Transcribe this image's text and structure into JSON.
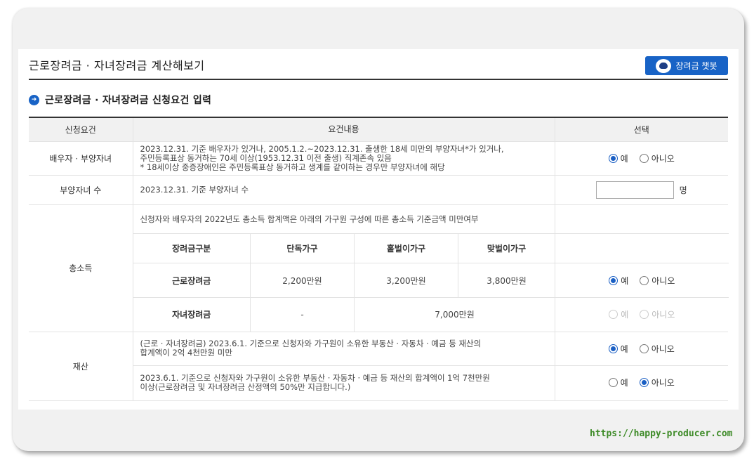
{
  "header": {
    "title": "근로장려금 · 자녀장려금 계산해보기",
    "chatbot_label": "장려금 챗봇"
  },
  "section": {
    "title": "근로장려금 · 자녀장려금 신청요건 입력"
  },
  "table": {
    "headers": [
      "신청요건",
      "요건내용",
      "선택"
    ],
    "rows": {
      "spouse": {
        "label": "배우자 · 부양자녀",
        "line1": "2023.12.31. 기준 배우자가 있거나, 2005.1.2.~2023.12.31. 출생한 18세 미만의 부양자녀*가 있거나,",
        "line2": "주민등록표상 동거하는 70세 이상(1953.12.31 이전 출생) 직계존속 있음",
        "line3": "* 18세이상 중증장애인은 주민등록표상 동거하고 생계를 같이하는 경우만 부양자녀에 해당",
        "yes": "예",
        "no": "아니오",
        "selected": "예"
      },
      "children": {
        "label": "부양자녀 수",
        "text": "2023.12.31. 기준 부양자녀 수",
        "input_value": "",
        "unit": "명"
      },
      "income": {
        "label": "총소득",
        "intro": "신청자와 배우자의 2022년도 총소득 합계액은 아래의 가구원 구성에 따른 총소득 기준금액 미만여부",
        "inner_headers": [
          "장려금구분",
          "단독가구",
          "홑벌이가구",
          "맞벌이가구"
        ],
        "work": {
          "name": "근로장려금",
          "single": "2,200만원",
          "one": "3,200만원",
          "two": "3,800만원",
          "yes": "예",
          "no": "아니오",
          "selected": "예"
        },
        "child": {
          "name": "자녀장려금",
          "single": "-",
          "combined": "7,000만원",
          "yes": "예",
          "no": "아니오",
          "selected": "none"
        }
      },
      "assets": {
        "label": "재산",
        "a_line1": "(근로 · 자녀장려금) 2023.6.1. 기준으로 신청자와 가구원이 소유한 부동산 · 자동차 · 예금 등 재산의",
        "a_line2": "합계액이 2억 4천만원 미만",
        "a_yes": "예",
        "a_no": "아니오",
        "a_selected": "예",
        "b_line1": "2023.6.1. 기준으로 신청자와 가구원이 소유한 부동산 · 자동차 · 예금 등 재산의 합계액이 1억 7천만원",
        "b_line2": "이상(근로장려금 및 자녀장려금 산정액의 50%만 지급합니다.)",
        "b_yes": "예",
        "b_no": "아니오",
        "b_selected": "아니오"
      }
    }
  },
  "watermark": "https://happy-producer.com",
  "colors": {
    "accent": "#1863c6",
    "watermark": "#3e8b28"
  },
  "icons": {
    "chatbot": "robot-icon",
    "section": "arrow-right-circle-icon"
  }
}
